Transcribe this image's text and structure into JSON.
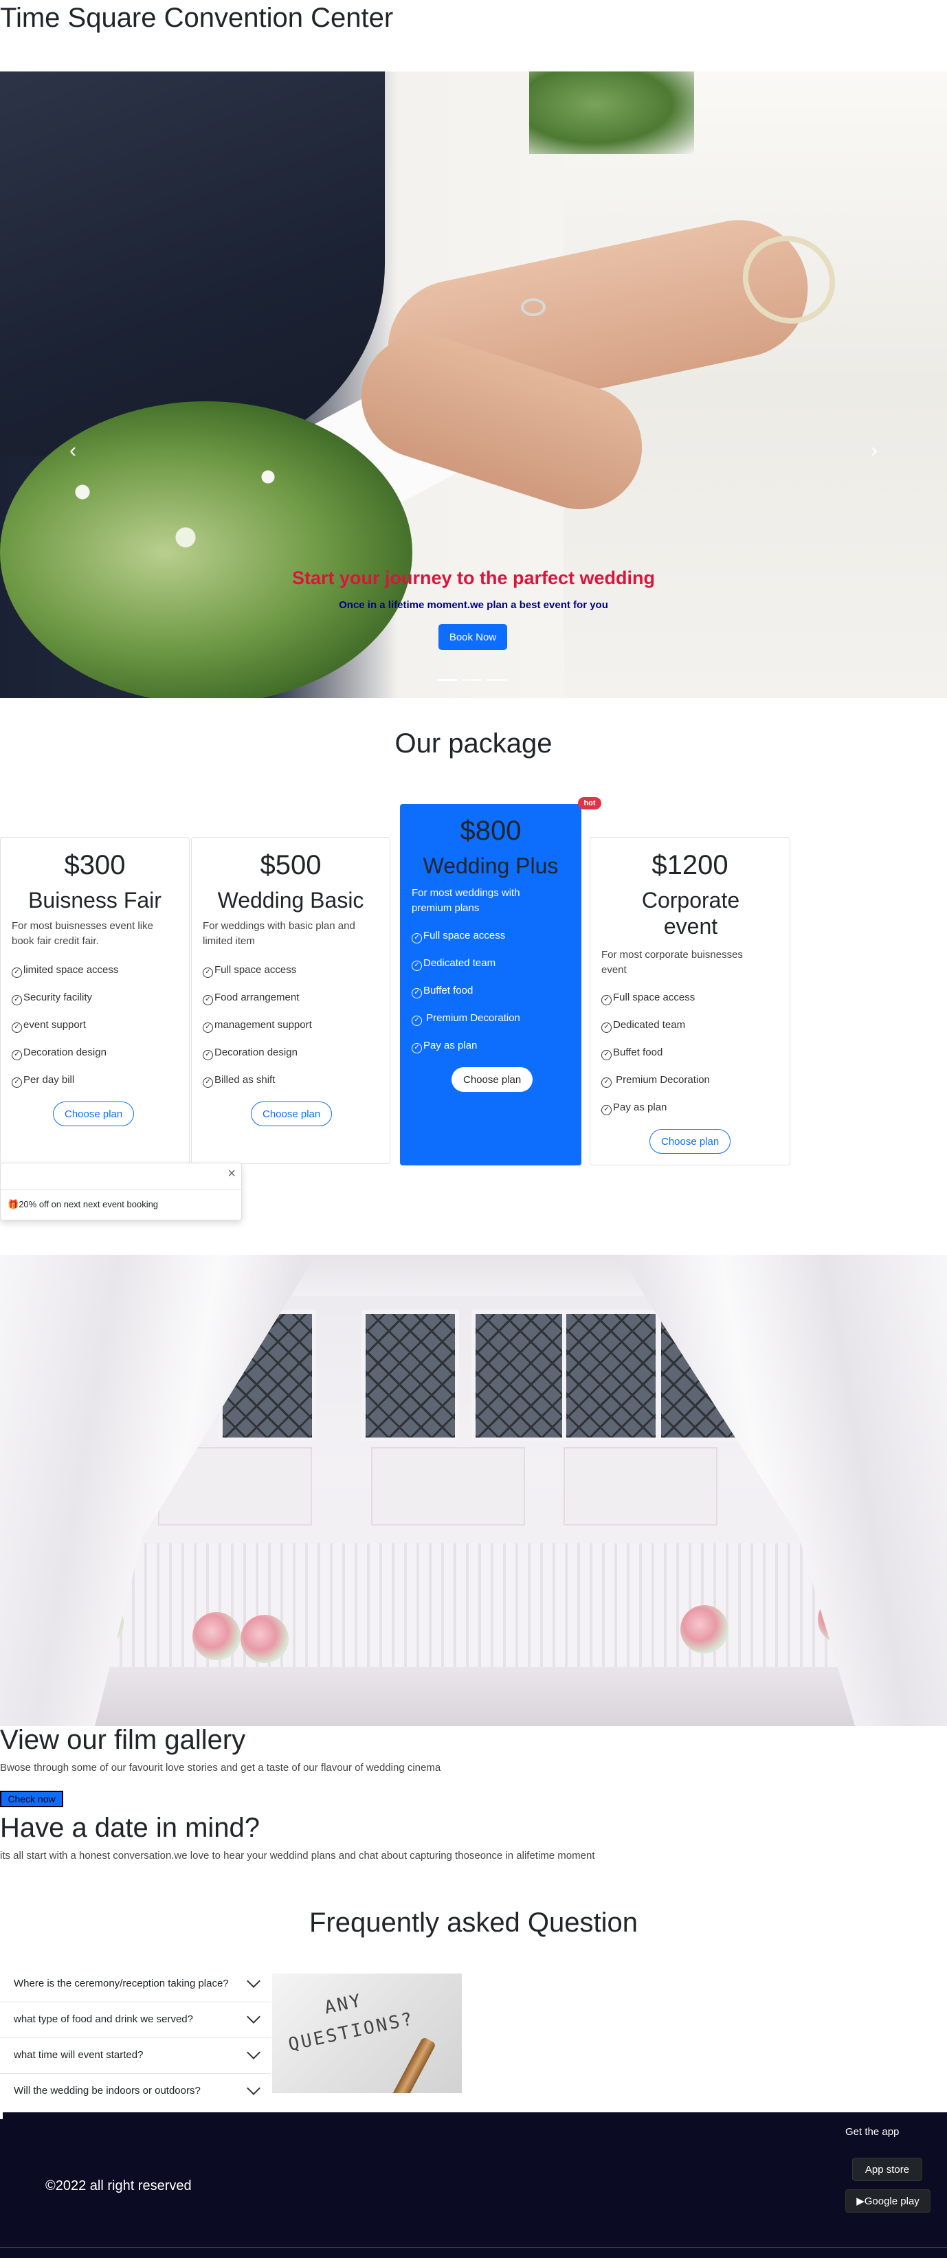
{
  "header": {
    "title": "Time Square Convention Center"
  },
  "hero": {
    "title": "Start your journey to the parfect wedding",
    "subtitle": "Once in a lifetime moment.we plan a best event for you",
    "button": "Book Now",
    "prev_icon": "chevron-left-icon",
    "next_icon": "chevron-right-icon",
    "indicators": 3,
    "active_indicator": 1
  },
  "packages": {
    "heading": "Our package",
    "badge": "hot",
    "cards": [
      {
        "price": "$300",
        "name": "Buisness Fair",
        "desc": "For most buisnesses event like book fair credit fair.",
        "features": [
          "limited space access",
          "Security facility",
          "event support",
          "Decoration design",
          "Per day bill"
        ],
        "button": "Choose plan"
      },
      {
        "price": "$500",
        "name": "Wedding Basic",
        "desc": "For weddings with basic plan and limited item",
        "features": [
          "Full space access",
          "Food arrangement",
          "management support",
          "Decoration design",
          "Billed as shift"
        ],
        "button": "Choose plan"
      },
      {
        "price": "$800",
        "name": "Wedding Plus",
        "desc": "For most weddings with premium plans",
        "features": [
          "Full space access",
          "Dedicated team",
          "Buffet food",
          " Premium Decoration",
          "Pay as plan"
        ],
        "button": "Choose plan"
      },
      {
        "price": "$1200",
        "name": "Corporate event",
        "desc": "For most corporate buisnesses event",
        "features": [
          "Full space access",
          "Dedicated team",
          "Buffet food",
          " Premium Decoration",
          "Pay as plan"
        ],
        "button": "Choose plan"
      }
    ]
  },
  "toast": {
    "close": "×",
    "message": "20% off on next next event booking",
    "icon": "gift-icon"
  },
  "gallery": {
    "title": "View our film gallery",
    "text": "Bwose through some of our favourit love stories and get a taste of our flavour of wedding cinema",
    "button": "Check now"
  },
  "date": {
    "title": "Have a date in mind?",
    "text": "its all start with a honest conversation.we love to hear your weddind plans and chat about capturing thoseonce in alifetime moment"
  },
  "faq": {
    "heading": "Frequently asked Question",
    "questions": [
      "Where is the ceremony/reception taking place?",
      "what type of food and drink we served?",
      "what time will event started?",
      "Will the wedding be indoors or outdoors?"
    ],
    "image_text_1": "ANY",
    "image_text_2": "QUESTIONS?"
  },
  "footer": {
    "copyright": "©2022 all right reserved",
    "get_app": "Get the app",
    "app_store": "App store",
    "google_play": "Google play",
    "background": "#0b0b23"
  },
  "colors": {
    "primary": "#0d6efd",
    "hero_title": "#dc143c",
    "hero_subtitle": "#00008b",
    "badge": "#dc3545"
  }
}
